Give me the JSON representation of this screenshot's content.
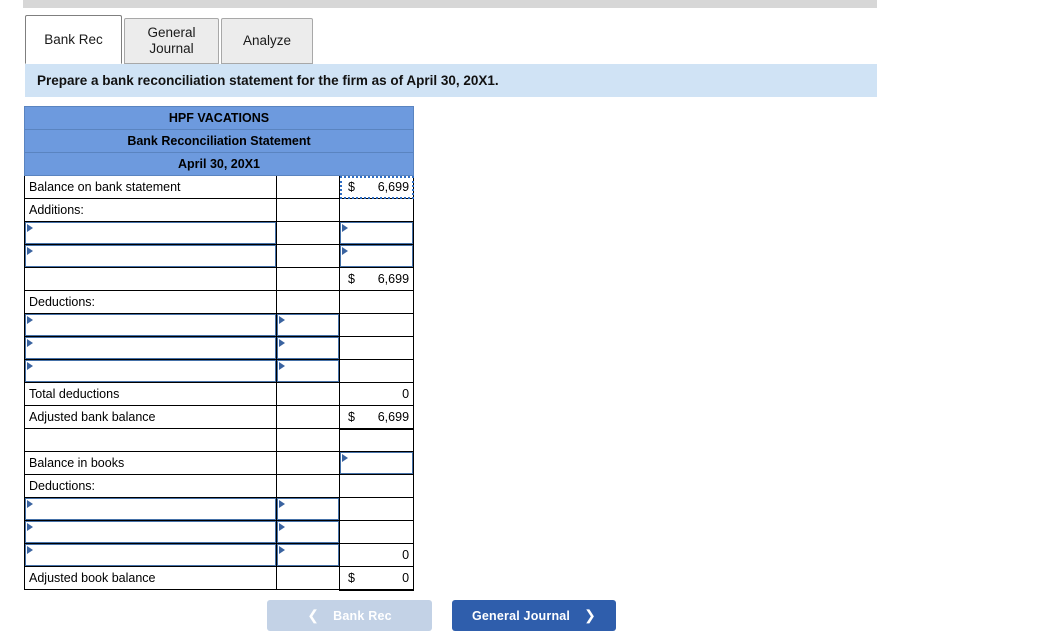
{
  "window": {
    "top_strip": ""
  },
  "tabs": [
    {
      "label": "Bank Rec",
      "active": true
    },
    {
      "label": "General Journal",
      "active": false
    },
    {
      "label": "Analyze",
      "active": false
    }
  ],
  "instruction": {
    "text": "Prepare a bank reconciliation statement for the firm as of April 30, 20X1."
  },
  "worksheet": {
    "title_lines": [
      "HPF VACATIONS",
      "Bank Reconciliation Statement",
      "April 30, 20X1"
    ],
    "rows": [
      {
        "label": "Balance on bank statement",
        "mid": "",
        "dollar": "$",
        "value": "6,699"
      },
      {
        "label": "Additions:",
        "mid": "",
        "dollar": "",
        "value": ""
      },
      {
        "label": "",
        "mid": "",
        "dollar": "",
        "value": ""
      },
      {
        "label": "",
        "mid": "",
        "dollar": "",
        "value": ""
      },
      {
        "label": "",
        "mid": "",
        "dollar": "$",
        "value": "6,699"
      },
      {
        "label": "Deductions:",
        "mid": "",
        "dollar": "",
        "value": ""
      },
      {
        "label": "",
        "mid": "",
        "dollar": "",
        "value": ""
      },
      {
        "label": "",
        "mid": "",
        "dollar": "",
        "value": ""
      },
      {
        "label": "",
        "mid": "",
        "dollar": "",
        "value": ""
      },
      {
        "label": "Total deductions",
        "mid": "",
        "dollar": "",
        "value": "0"
      },
      {
        "label": "Adjusted bank balance",
        "mid": "",
        "dollar": "$",
        "value": "6,699"
      },
      {
        "label": "",
        "mid": "",
        "dollar": "",
        "value": ""
      },
      {
        "label": "Balance in books",
        "mid": "",
        "dollar": "",
        "value": ""
      },
      {
        "label": "Deductions:",
        "mid": "",
        "dollar": "",
        "value": ""
      },
      {
        "label": "",
        "mid": "",
        "dollar": "",
        "value": ""
      },
      {
        "label": "",
        "mid": "",
        "dollar": "",
        "value": ""
      },
      {
        "label": "",
        "mid": "",
        "dollar": "",
        "value": "0"
      },
      {
        "label": "Adjusted book balance",
        "mid": "",
        "dollar": "$",
        "value": "0"
      }
    ]
  },
  "footer": {
    "prev_label": "Bank Rec",
    "prev_icon": "chevron-left-icon",
    "prev_disabled": true,
    "next_label": "General Journal",
    "next_icon": "chevron-right-icon"
  },
  "colors": {
    "header_blue": "#6d9ade",
    "banner_blue": "#d0e3f5",
    "input_border": "#4571a8",
    "primary_button": "#2f5eac",
    "disabled_button": "#c3d2e6"
  }
}
